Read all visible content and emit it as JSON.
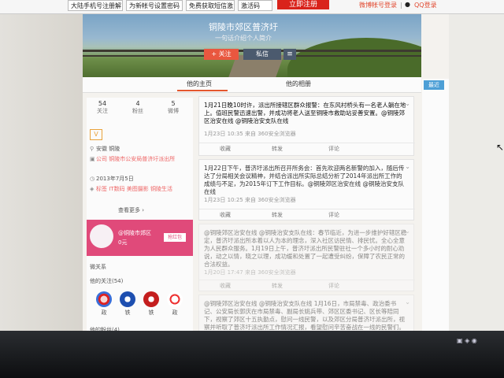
{
  "toolbar": {
    "buttons": [
      "大陆手机号注册解",
      "为新帐号设置密码",
      "免费获取短信激",
      "激活码"
    ],
    "register": "立即注册",
    "weibo_login": "微博帐号登录",
    "qq_login": "QQ登录"
  },
  "profile": {
    "name": "铜陵市郊区普济圩",
    "intro": "一句话介绍个人简介",
    "follow": "+ 关注",
    "message": "私信",
    "menu": "≡"
  },
  "tabs": [
    "他的主页",
    "他的相册"
  ],
  "stats": [
    {
      "num": "54",
      "label": "关注"
    },
    {
      "num": "4",
      "label": "粉丝"
    },
    {
      "num": "5",
      "label": "微博"
    }
  ],
  "info": {
    "badge": "V",
    "location": "安徽 铜陵",
    "company": "公司 铜陵市公安局普济圩派出所",
    "joined": "2013年7月5日",
    "tags": "标签 IT数码 美图摄影 铜陵生活",
    "more": "查看更多 ›"
  },
  "promo": {
    "title": "@铜陵市郊区",
    "sub": "0元",
    "button": "抢红包"
  },
  "relations": {
    "title": "微关系",
    "following": "他的关注(54)",
    "names": [
      "政",
      "铁",
      "铁",
      "政"
    ],
    "fans": "他的粉丝(4)"
  },
  "posts": [
    {
      "text": "1月21日晚10时许，派出所接辖区群众报警：在东风村桥头有一名老人躺在地上。值班民警迅速出警，并成功将老人送至铜陵市救助站妥善安置。@铜陵郊区治安在线 @铜陵治安支队在线",
      "meta": "1月23日 10:35 来自 360安全浏览器",
      "actions": [
        "收藏",
        "转发",
        "评论"
      ]
    },
    {
      "text": "1月22日下午，普济圩派出所召开所务会：首先欢迎两名新警的加入，随后传达了分局相关会议精神，并结合派出所实际总结分析了2014年派出所工作的成绩与不足，为2015年订下工作目标。@铜陵郊区治安在线 @铜陵治安支队在线",
      "meta": "1月23日 10:25 来自 360安全浏览器",
      "actions": [
        "收藏",
        "转发",
        "评论"
      ]
    },
    {
      "text": "@铜陵郊区治安在线 @铜陵治安支队在线：春节临近，为进一步维护好辖区稳定，普济圩派出所本着以人为本的理念，深入社区访民情、排民忧。全心全意为人民群众服务。1月19日上午，普济圩派出所民警驻社一个多小时的耐心劝说，动之以情，晓之以理，成功缓和处置了一起遭受纠纷，保障了农民正常的合法权益。",
      "meta": "1月20日 17:47 来自 360安全浏览器",
      "actions": [
        "收藏",
        "转发",
        "评论"
      ]
    },
    {
      "text": "@铜陵郊区治安在线 @铜陵治安支队在线 1月16日，市局禁毒、政治委书记、公安局长郭庆在市局禁毒、副局长姚兵带、郊区区委书记、区长等陪同下，视察了郊区十五执勤点，慰问一线民警，以及郊区分局普济圩派出所，视察并听取了普济圩派出所工作情况汇报，看望慰问辛苦奋战在一线的民警们。",
      "meta": "",
      "actions": []
    }
  ],
  "sidebar": {
    "recent": "最近"
  },
  "colors": {
    "accent": "#e9573f",
    "register": "#d9231b",
    "promo": "#e04a7a",
    "link": "#4d9fd6"
  }
}
